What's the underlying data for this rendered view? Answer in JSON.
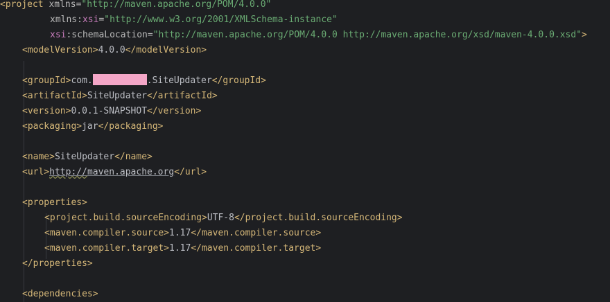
{
  "file_lines": {
    "l1": {
      "open": "<project ",
      "a1": "xmlns",
      "eq": "=",
      "v1": "\"http://maven.apache.org/POM/4.0.0\""
    },
    "l2": {
      "a": "xmlns:",
      "ns": "xsi",
      "eq": "=",
      "v": "\"http://www.w3.org/2001/XMLSchema-instance\""
    },
    "l3": {
      "ns": "xsi",
      "a": ":schemaLocation",
      "eq": "=",
      "v": "\"http://maven.apache.org/POM/4.0.0 http://maven.apache.org/xsd/maven-4.0.0.xsd\"",
      "close": ">"
    },
    "l4": {
      "o": "<modelVersion>",
      "t": "4.0.0",
      "c": "</modelVersion>"
    },
    "l6": {
      "o": "<groupId>",
      "t1": "com.",
      "t2": ".SiteUpdater",
      "c": "</groupId>"
    },
    "l7": {
      "o": "<artifactId>",
      "t": "SiteUpdater",
      "c": "</artifactId>"
    },
    "l8": {
      "o": "<version>",
      "t": "0.0.1-SNAPSHOT",
      "c": "</version>"
    },
    "l9": {
      "o": "<packaging>",
      "t": "jar",
      "c": "</packaging>"
    },
    "l11": {
      "o": "<name>",
      "t": "SiteUpdater",
      "c": "</name>"
    },
    "l12": {
      "o": "<url>",
      "t1": "http://",
      "t2": "maven.apache.org",
      "c": "</url>"
    },
    "l14": {
      "o": "<properties>"
    },
    "l15": {
      "o": "<project.build.sourceEncoding>",
      "t": "UTF-8",
      "c": "</project.build.sourceEncoding>"
    },
    "l16": {
      "o": "<maven.compiler.source>",
      "t": "1.17",
      "c": "</maven.compiler.source>"
    },
    "l17": {
      "o": "<maven.compiler.target>",
      "t": "1.17",
      "c": "</maven.compiler.target>"
    },
    "l18": {
      "c": "</properties>"
    },
    "l20": {
      "o": "<dependencies>"
    }
  },
  "colors": {
    "background": "#1e1f22",
    "tag": "#d5b778",
    "attribute": "#bababa",
    "namespace": "#c77dbb",
    "string": "#6aab73",
    "text": "#bcbec4",
    "redaction": "#f4a6c7"
  }
}
